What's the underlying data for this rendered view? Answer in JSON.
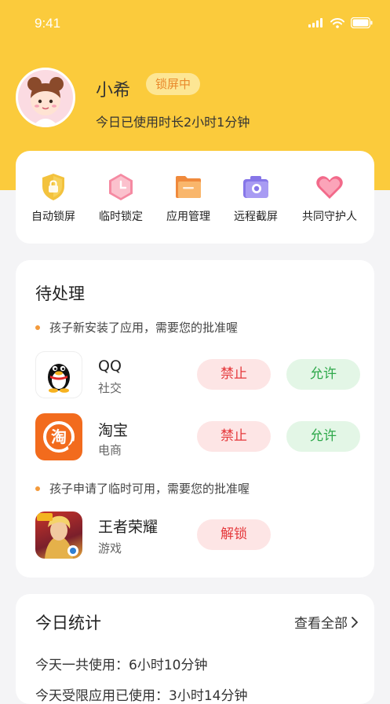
{
  "status_bar": {
    "time": "9:41"
  },
  "profile": {
    "name": "小希",
    "badge": "锁屏中",
    "usage_today": "今日已使用时长2小时1分钟"
  },
  "quick_actions": [
    {
      "label": "自动锁屏",
      "icon": "shield-lock-icon"
    },
    {
      "label": "临时锁定",
      "icon": "clock-hexagon-icon"
    },
    {
      "label": "应用管理",
      "icon": "folder-icon"
    },
    {
      "label": "远程截屏",
      "icon": "camera-icon"
    },
    {
      "label": "共同守护人",
      "icon": "heart-icon"
    }
  ],
  "pending": {
    "title": "待处理",
    "notice_install": "孩子新安装了应用，需要您的批准喔",
    "notice_temp": "孩子申请了临时可用，需要您的批准喔",
    "apps": [
      {
        "name": "QQ",
        "category": "社交",
        "deny": "禁止",
        "allow": "允许"
      },
      {
        "name": "淘宝",
        "category": "电商",
        "deny": "禁止",
        "allow": "允许",
        "icon_text": "淘"
      }
    ],
    "temp_app": {
      "name": "王者荣耀",
      "category": "游戏",
      "unlock": "解锁"
    }
  },
  "stats": {
    "title": "今日统计",
    "view_all": "查看全部",
    "line1": "今天一共使用：6小时10分钟",
    "line2": "今天受限应用已使用：3小时14分钟"
  },
  "colors": {
    "header": "#fbcb3c",
    "deny": "#e5383b",
    "allow": "#2ea84a"
  }
}
